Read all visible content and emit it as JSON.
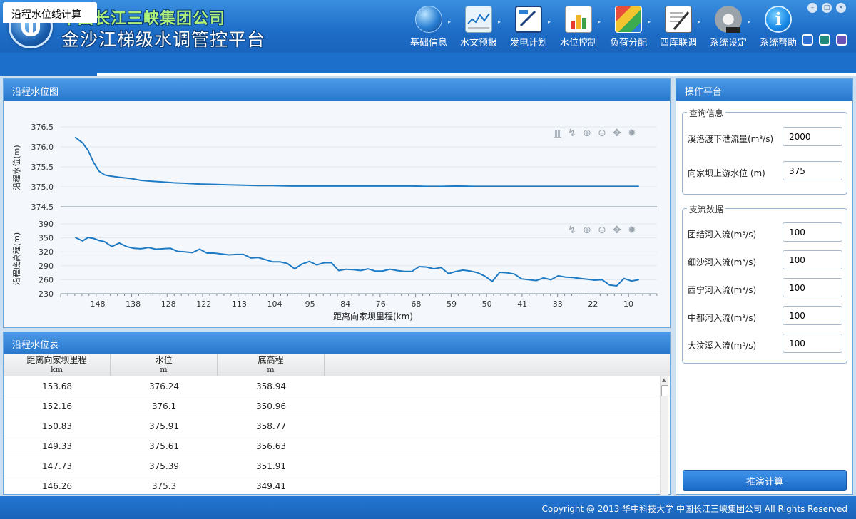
{
  "header": {
    "company": "中国长江三峡集团公司",
    "platform": "金沙江梯级水调管控平台"
  },
  "nav": [
    {
      "label": "基础信息",
      "icon": "globe-icon"
    },
    {
      "label": "水文预报",
      "icon": "hydrology-chart-icon"
    },
    {
      "label": "发电计划",
      "icon": "generation-plan-icon"
    },
    {
      "label": "水位控制",
      "icon": "water-level-bar-icon"
    },
    {
      "label": "负荷分配",
      "icon": "load-allocation-icon"
    },
    {
      "label": "四库联调",
      "icon": "document-edit-icon"
    },
    {
      "label": "系统设定",
      "icon": "gear-icon"
    },
    {
      "label": "系统帮助",
      "icon": "info-icon"
    }
  ],
  "skins": [
    {
      "color": "#2a6fd1"
    },
    {
      "color": "#1f8a7a"
    },
    {
      "color": "#6a53b8"
    }
  ],
  "tab": {
    "label": "沿程水位线计算"
  },
  "chart_panel": {
    "title": "沿程水位图"
  },
  "chart_data": [
    {
      "type": "line",
      "title": "",
      "ylabel": "沿程水位(m)",
      "xlabel": "",
      "ylim": [
        374.5,
        376.5
      ],
      "yticks": [
        "376.5",
        "376.0",
        "375.5",
        "375.0",
        "374.5"
      ],
      "grid": true,
      "x": [
        154,
        152,
        150.5,
        149,
        147.5,
        146,
        144.5,
        142,
        139,
        136,
        133,
        130,
        127,
        124,
        120,
        116,
        112,
        108,
        104,
        100,
        95,
        90,
        86,
        82,
        78,
        74,
        70,
        66,
        62,
        58,
        54,
        50,
        45,
        40,
        35,
        30,
        25,
        20,
        15,
        10,
        5,
        0
      ],
      "series": [
        {
          "values": [
            376.24,
            376.1,
            375.91,
            375.61,
            375.39,
            375.3,
            375.27,
            375.24,
            375.21,
            375.16,
            375.14,
            375.12,
            375.1,
            375.09,
            375.07,
            375.06,
            375.05,
            375.04,
            375.03,
            375.03,
            375.02,
            375.02,
            375.02,
            375.02,
            375.02,
            375.02,
            375.02,
            375.02,
            375.02,
            375.01,
            375.01,
            375.02,
            375.01,
            375.01,
            375.01,
            375.01,
            375.01,
            375.01,
            375.01,
            375.01,
            375.01,
            375.01
          ]
        }
      ]
    },
    {
      "type": "line",
      "title": "",
      "ylabel": "沿程底高程(m)",
      "xlabel": "距离向家坝里程(km)",
      "ylim": [
        230,
        390
      ],
      "yticks": [
        "390",
        "350",
        "320",
        "290",
        "260",
        "230"
      ],
      "xticks": [
        "148",
        "138",
        "128",
        "122",
        "113",
        "104",
        "95",
        "84",
        "76",
        "68",
        "59",
        "50",
        "41",
        "33",
        "22",
        "10"
      ],
      "grid": true,
      "x": [
        154,
        152,
        150.5,
        149,
        147.5,
        146,
        144,
        142,
        140,
        138,
        136,
        134,
        132,
        130,
        128,
        126,
        124,
        122,
        120,
        118,
        116,
        114,
        112,
        110,
        108,
        106,
        104,
        102,
        100,
        98,
        96,
        94,
        92,
        90,
        88,
        86,
        84,
        82,
        80,
        78,
        76,
        74,
        72,
        70,
        68,
        66,
        64,
        62,
        60,
        58,
        56,
        54,
        52,
        50,
        48,
        46,
        44,
        42,
        40,
        38,
        36,
        34,
        32,
        30,
        28,
        26,
        24,
        22,
        20,
        18,
        16,
        14,
        12,
        10,
        8,
        6,
        4,
        2,
        0
      ],
      "series": [
        {
          "values": [
            358.94,
            350.96,
            358.77,
            356.63,
            351.91,
            349.41,
            338,
            346,
            338,
            334,
            333,
            336,
            332,
            333,
            334,
            327,
            326,
            324,
            332,
            323,
            323,
            321,
            319,
            320,
            320,
            312,
            313,
            308,
            303,
            303,
            299,
            287,
            298,
            304,
            296,
            301,
            301,
            283,
            286,
            285,
            283,
            287,
            282,
            282,
            286,
            283,
            281,
            281,
            292,
            291,
            287,
            290,
            276,
            281,
            284,
            282,
            278,
            270,
            258,
            279,
            278,
            275,
            264,
            262,
            260,
            266,
            262,
            271,
            268,
            267,
            265,
            263,
            261,
            262,
            250,
            248,
            265,
            259,
            262
          ]
        }
      ]
    }
  ],
  "chart_tools": [
    "bar-chart-icon",
    "restore-icon",
    "zoom-in-icon",
    "zoom-out-icon",
    "pan-icon",
    "settings-icon"
  ],
  "table_panel": {
    "title": "沿程水位表"
  },
  "table": {
    "columns": [
      {
        "label": "距离向家坝里程",
        "unit": "km"
      },
      {
        "label": "水位",
        "unit": "m"
      },
      {
        "label": "底高程",
        "unit": "m"
      }
    ],
    "rows": [
      [
        "153.68",
        "376.24",
        "358.94"
      ],
      [
        "152.16",
        "376.1",
        "350.96"
      ],
      [
        "150.83",
        "375.91",
        "358.77"
      ],
      [
        "149.33",
        "375.61",
        "356.63"
      ],
      [
        "147.73",
        "375.39",
        "351.91"
      ],
      [
        "146.26",
        "375.3",
        "349.41"
      ]
    ]
  },
  "op_panel": {
    "title": "操作平台",
    "query": {
      "legend": "查询信息",
      "fields": [
        {
          "label": "溪洛渡下泄流量(m³/s)",
          "value": "2000"
        },
        {
          "label": "向家坝上游水位 (m)",
          "value": "375"
        }
      ]
    },
    "tributary": {
      "legend": "支流数据",
      "fields": [
        {
          "label": "团结河入流(m³/s)",
          "value": "100"
        },
        {
          "label": "细沙河入流(m³/s)",
          "value": "100"
        },
        {
          "label": "西宁河入流(m³/s)",
          "value": "100"
        },
        {
          "label": "中都河入流(m³/s)",
          "value": "100"
        },
        {
          "label": "大汶溪入流(m³/s)",
          "value": "100"
        }
      ]
    },
    "button": "推演计算"
  },
  "footer": {
    "text": "Copyright @ 2013  华中科技大学 中国长江三峡集团公司 All Rights Reserved"
  }
}
